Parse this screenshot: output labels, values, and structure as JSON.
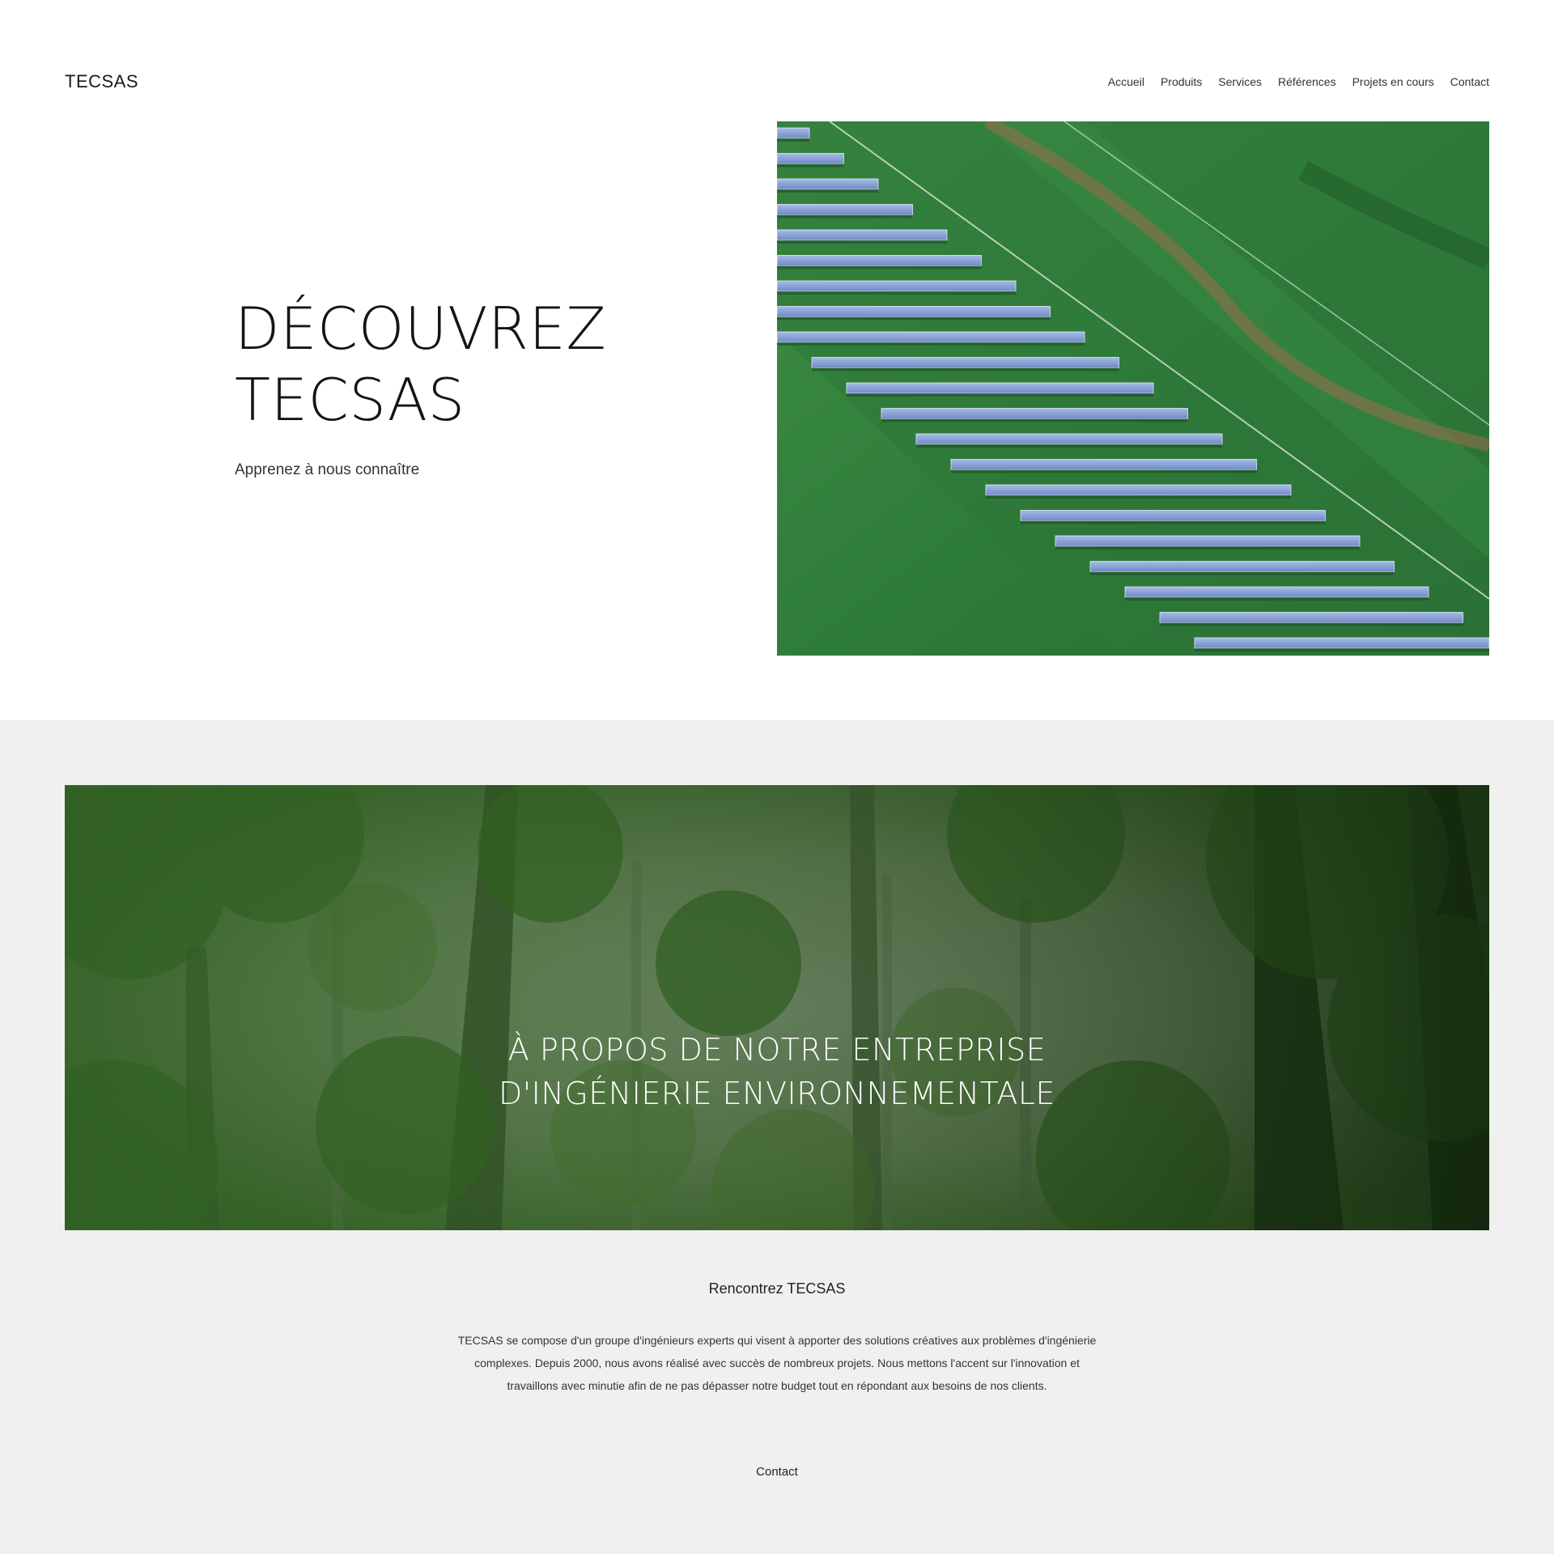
{
  "header": {
    "logo": "TECSAS",
    "nav": [
      "Accueil",
      "Produits",
      "Services",
      "Références",
      "Projets en cours",
      "Contact"
    ]
  },
  "hero": {
    "title_line1": "DÉCOUVREZ",
    "title_line2": "TECSAS",
    "subtitle": "Apprenez à nous connaître"
  },
  "about": {
    "banner_line1": "À PROPOS DE NOTRE ENTREPRISE",
    "banner_line2": "D'INGÉNIERIE ENVIRONNEMENTALE",
    "meet": "Rencontrez TECSAS",
    "text": "TECSAS se compose d'un groupe d'ingénieurs experts qui visent à apporter des solutions créatives aux problèmes d'ingénierie complexes. Depuis 2000, nous avons réalisé avec succès de nombreux projets. Nous mettons l'accent sur l'innovation et travaillons avec minutie afin de ne pas dépasser notre budget tout en répondant aux besoins de nos clients.",
    "contact": "Contact"
  },
  "colors": {
    "background": "#ffffff",
    "section_gray": "#f0f0f0",
    "field_green": "#2f7a3c",
    "panel_blue": "#8fa6d6"
  }
}
